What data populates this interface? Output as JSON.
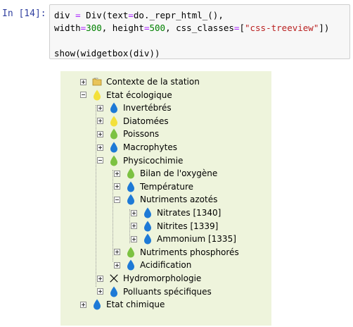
{
  "cell": {
    "prompt": "In [14]:",
    "code": {
      "line1": {
        "a": "div ",
        "op": "=",
        "b": " Div(text",
        "op2": "=",
        "c": "do._repr_html_(),"
      },
      "line2": {
        "a": "width",
        "op": "=",
        "n1": "300",
        "b": ", height",
        "op2": "=",
        "n2": "500",
        "c": ", css_classes",
        "op3": "=",
        "d": "[",
        "s": "\"css-treeview\"",
        "e": "])"
      },
      "line4": "show(widgetbox(div))"
    }
  },
  "tree": {
    "nodes": [
      {
        "label": "Contexte de la station",
        "icon": "folder-icon",
        "toggle": "plus"
      },
      {
        "label": "Etat écologique",
        "icon": "yellow-drop-icon",
        "toggle": "minus"
      },
      {
        "label": "Invertébrés",
        "icon": "blue-drop-icon",
        "toggle": "plus"
      },
      {
        "label": "Diatomées",
        "icon": "yellow-drop-icon",
        "toggle": "plus"
      },
      {
        "label": "Poissons",
        "icon": "green-drop-icon",
        "toggle": "plus"
      },
      {
        "label": "Macrophytes",
        "icon": "blue-drop-icon",
        "toggle": "plus"
      },
      {
        "label": "Physicochimie",
        "icon": "green-drop-icon",
        "toggle": "minus"
      },
      {
        "label": "Bilan de l'oxygène",
        "icon": "green-drop-icon",
        "toggle": "plus"
      },
      {
        "label": "Température",
        "icon": "blue-drop-icon",
        "toggle": "plus"
      },
      {
        "label": "Nutriments azotés",
        "icon": "blue-drop-icon",
        "toggle": "minus"
      },
      {
        "label": "Nitrates [1340]",
        "icon": "blue-drop-icon",
        "toggle": "plus"
      },
      {
        "label": "Nitrites [1339]",
        "icon": "blue-drop-icon",
        "toggle": "plus"
      },
      {
        "label": "Ammonium [1335]",
        "icon": "blue-drop-icon",
        "toggle": "plus"
      },
      {
        "label": "Nutriments phosphorés",
        "icon": "green-drop-icon",
        "toggle": "plus"
      },
      {
        "label": "Acidification",
        "icon": "blue-drop-icon",
        "toggle": "plus"
      },
      {
        "label": "Hydromorphologie",
        "icon": "cross-icon",
        "toggle": "plus"
      },
      {
        "label": "Polluants spécifiques",
        "icon": "blue-drop-icon",
        "toggle": "plus"
      },
      {
        "label": "Etat chimique",
        "icon": "blue-drop-icon",
        "toggle": "plus"
      }
    ]
  },
  "colors": {
    "blue_drop": "#1e7ad6",
    "green_drop": "#7cc242",
    "yellow_drop": "#f3e03a",
    "tree_bg": "#eef4dc"
  }
}
